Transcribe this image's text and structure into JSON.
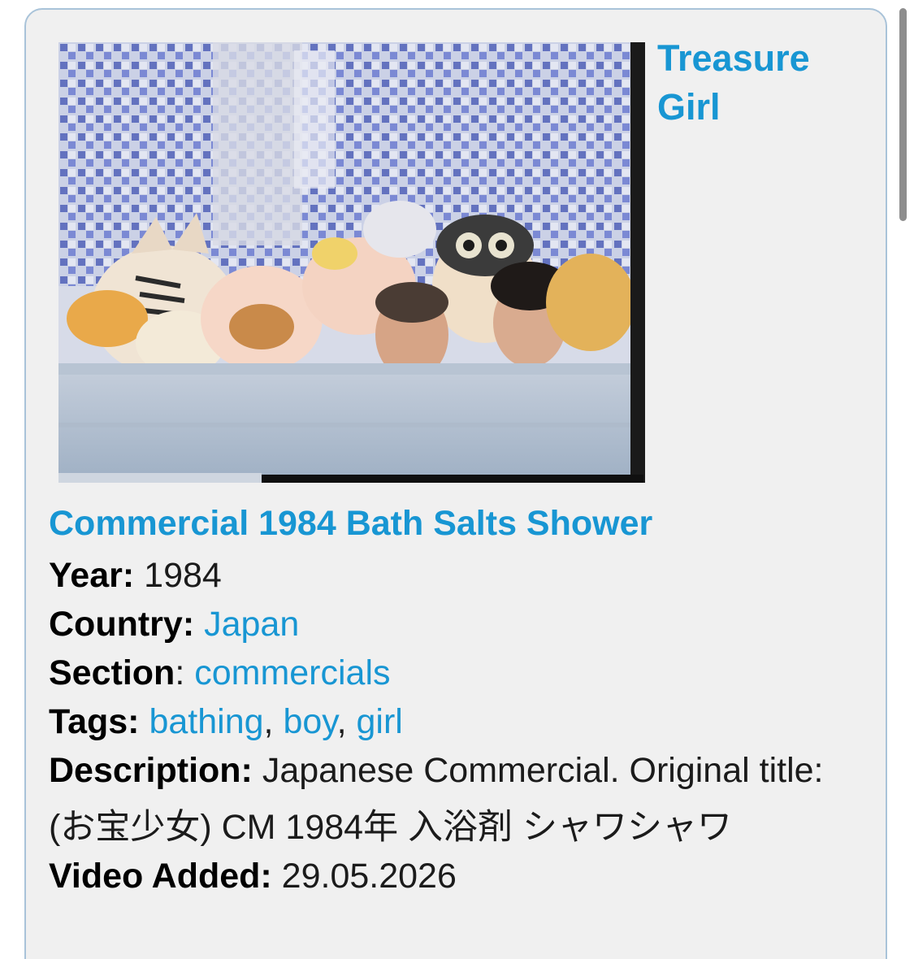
{
  "side_title": "Treasure Girl",
  "thumbnail": {
    "icon": "video-thumbnail-icon"
  },
  "video_title": "Commercial 1984 Bath Salts Shower",
  "meta": {
    "year": {
      "label": "Year:",
      "value": " 1984"
    },
    "country": {
      "label": "Country:",
      "value": "Japan"
    },
    "section": {
      "label": "Section",
      "colon": ": ",
      "value": "commercials"
    },
    "tags": {
      "label": "Tags:",
      "items": [
        "bathing",
        "boy",
        "girl"
      ],
      "sep": ", "
    },
    "description": {
      "label": "Description:",
      "value": " Japanese Commercial. Original title: (お宝少女) CM 1984年 入浴剤 シャワシャワ"
    },
    "video_added": {
      "label": "Video Added:",
      "value": " 29.05.2026"
    }
  },
  "colors": {
    "link": "#1896d3",
    "card_bg": "#f0f0f0",
    "card_border": "#a9c3d9"
  }
}
